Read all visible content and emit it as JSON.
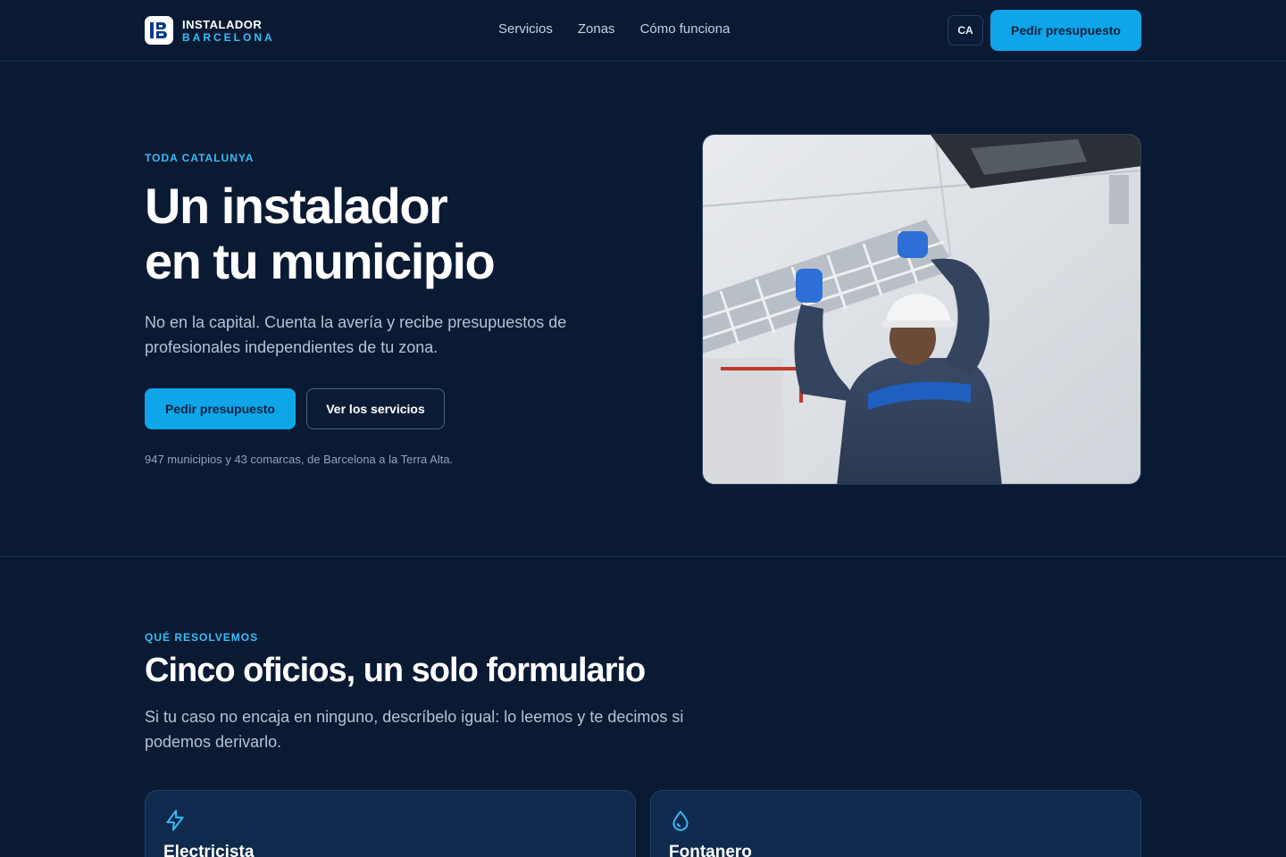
{
  "brand": {
    "line1": "INSTALADOR",
    "line2": "BARCELONA",
    "logo_icon": "ib-logo-icon"
  },
  "nav": {
    "items": [
      "Servicios",
      "Zonas",
      "Cómo funciona"
    ]
  },
  "header": {
    "lang": "CA",
    "cta": "Pedir presupuesto"
  },
  "hero": {
    "eyebrow": "TODA CATALUNYA",
    "title_line1": "Un instalador",
    "title_line2": "en tu municipio",
    "subtitle": "No en la capital. Cuenta la avería y recibe presupuestos de profesionales independientes de tu zona.",
    "primary_cta": "Pedir presupuesto",
    "secondary_cta": "Ver los servicios",
    "note": "947 municipios y 43 comarcas, de Barcelona a la Terra Alta."
  },
  "services": {
    "eyebrow": "QUÉ RESOLVEMOS",
    "title": "Cinco oficios, un solo formulario",
    "subtitle": "Si tu caso no encaja en ninguno, descríbelo igual: lo leemos y te decimos si podemos derivarlo.",
    "cards": [
      {
        "title": "Electricista",
        "icon": "lightning-icon"
      },
      {
        "title": "Fontanero",
        "icon": "water-drop-icon"
      }
    ]
  },
  "colors": {
    "background": "#0a1a33",
    "accent": "#0ea5e9",
    "eyebrow": "#38bdf8",
    "card": "#0f2a4d"
  }
}
